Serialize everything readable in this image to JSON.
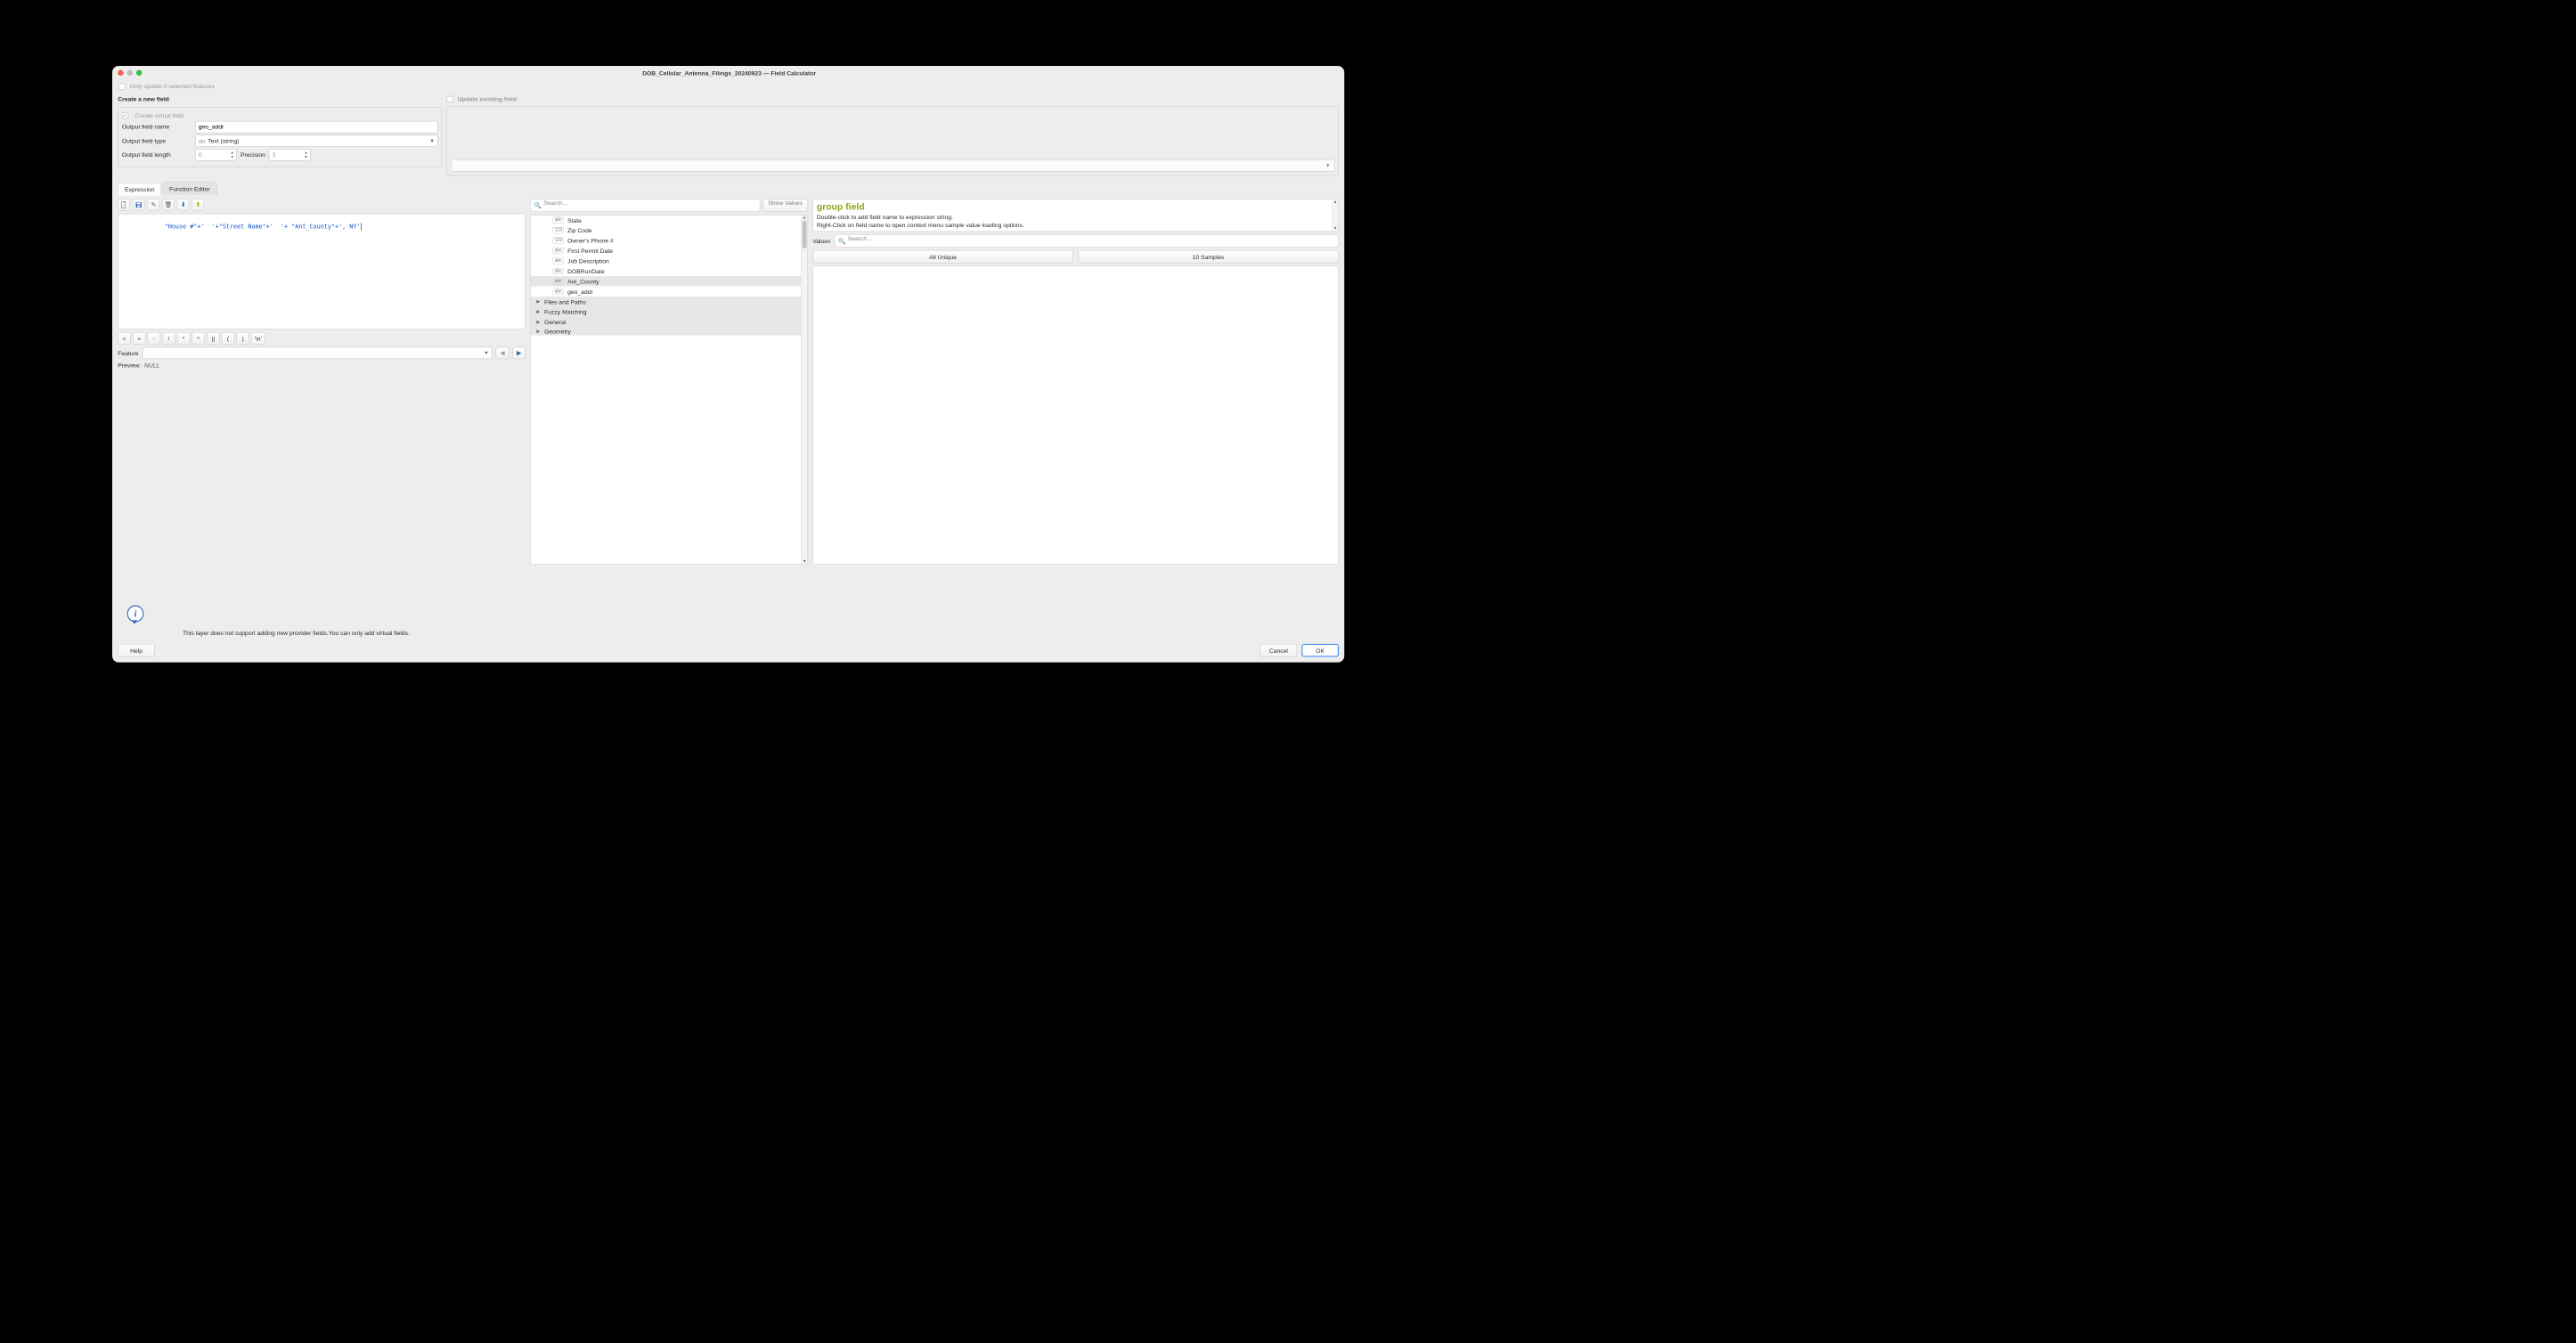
{
  "window_title": "DOB_Cellular_Antenna_Filings_20240923 — Field Calculator",
  "only_update_label": "Only update 0 selected features",
  "create_field": {
    "title": "Create a new field",
    "virtual_label": "Create virtual field",
    "name_label": "Output field name",
    "name_value": "geo_addr",
    "type_label": "Output field type",
    "type_badge": "abc",
    "type_value": "Text (string)",
    "length_label": "Output field length",
    "length_value": "0",
    "precision_label": "Precision",
    "precision_value": "3"
  },
  "update_field": {
    "title": "Update existing field"
  },
  "tabs": {
    "expression": "Expression",
    "function_editor": "Function Editor"
  },
  "expression": "\"House #\"+'  '+\"Street Name\"+'  '+ \"Ant_County\"+', NY'",
  "operators": [
    "=",
    "+",
    "-",
    "/",
    "*",
    "^",
    "||",
    "(",
    ")",
    "'\\n'"
  ],
  "feature_label": "Feature",
  "preview_label": "Preview:",
  "preview_value": "NULL",
  "search_placeholder": "Search…",
  "show_values": "Show Values",
  "fields": [
    {
      "t": "abc",
      "n": "State"
    },
    {
      "t": "123",
      "n": "Zip Code"
    },
    {
      "t": "123",
      "n": "Owner's  Phone #"
    },
    {
      "t": "abc",
      "n": "First Permit  Date"
    },
    {
      "t": "abc",
      "n": "Job Description"
    },
    {
      "t": "abc",
      "n": "DOBRunDate"
    },
    {
      "t": "abc",
      "n": "Ant_County",
      "sel": true
    },
    {
      "t": "abc",
      "n": "geo_addr"
    }
  ],
  "categories": [
    "Files and Paths",
    "Fuzzy Matching",
    "General",
    "Geometry"
  ],
  "help": {
    "title": "group field",
    "line1": "Double-click to add field name to expression string.",
    "line2": "Right-Click on field name to open context menu sample value loading options."
  },
  "values_label": "Values",
  "values_search_placeholder": "Search…",
  "all_unique": "All Unique",
  "ten_samples": "10 Samples",
  "info_text": "This layer does not support adding new provider fields.You can only add virtual fields.",
  "buttons": {
    "help": "Help",
    "cancel": "Cancel",
    "ok": "OK"
  }
}
